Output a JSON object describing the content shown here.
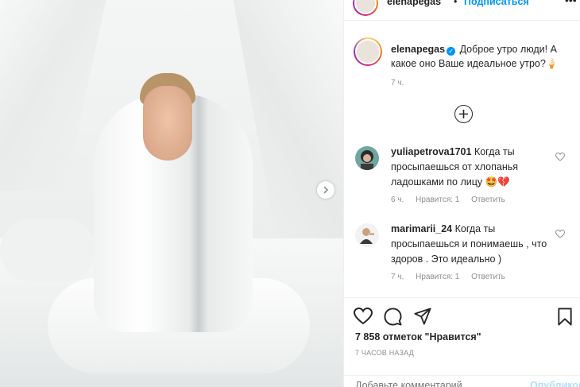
{
  "post": {
    "author": "elenapegas",
    "follow_label": "Подписаться",
    "dot": "•",
    "caption_text": "Доброе утро люди! А какое оно Ваше идеальное утро?",
    "caption_emoji": "🍦",
    "caption_time": "7 ч."
  },
  "comments": [
    {
      "user": "yuliapetrova1701",
      "text": "Когда ты просыпаешься от хлопанья ладошками по лицу",
      "emoji": "🤩💔",
      "time": "6 ч.",
      "likes": "Нравится: 1",
      "reply": "Ответить"
    },
    {
      "user": "marimarii_24",
      "text": "Когда ты просыпаешься и понимаешь , что здоров . Это идеально )",
      "emoji": "",
      "time": "7 ч.",
      "likes": "Нравится: 1",
      "reply": "Ответить"
    }
  ],
  "footer": {
    "likes_count": "7 858 отметок \"Нравится\"",
    "posted_ago": "7 ЧАСОВ НАЗАД",
    "comment_placeholder": "Добавьте комментарий...",
    "publish_label": "Опубликовать"
  },
  "colors": {
    "accent": "#0095f6",
    "publish_disabled": "#b2dffc",
    "muted": "#8e8e8e"
  }
}
